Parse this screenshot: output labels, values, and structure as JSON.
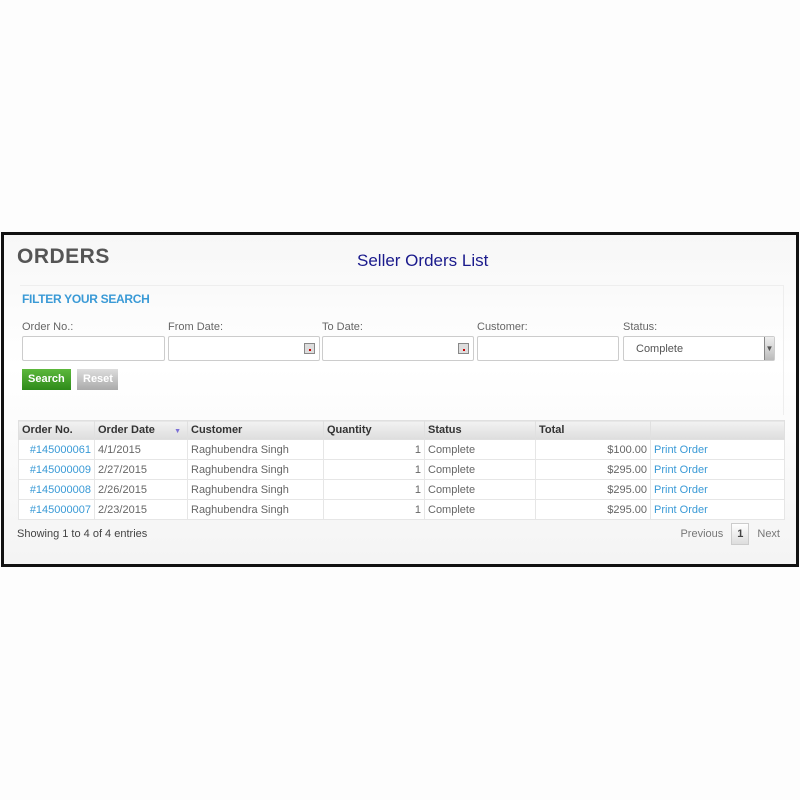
{
  "header": {
    "title": "ORDERS",
    "subtitle": "Seller Orders List"
  },
  "filter": {
    "heading": "FILTER YOUR SEARCH",
    "order_no_label": "Order No.:",
    "from_date_label": "From Date:",
    "to_date_label": "To Date:",
    "customer_label": "Customer:",
    "status_label": "Status:",
    "status_value": "Complete",
    "search_label": "Search",
    "reset_label": "Reset"
  },
  "table": {
    "columns": [
      "Order No.",
      "Order Date",
      "Customer",
      "Quantity",
      "Status",
      "Total",
      ""
    ],
    "rows": [
      [
        "#145000061",
        "4/1/2015",
        "Raghubendra Singh",
        "1",
        "Complete",
        "$100.00",
        "Print Order"
      ],
      [
        "#145000009",
        "2/27/2015",
        "Raghubendra Singh",
        "1",
        "Complete",
        "$295.00",
        "Print Order"
      ],
      [
        "#145000008",
        "2/26/2015",
        "Raghubendra Singh",
        "1",
        "Complete",
        "$295.00",
        "Print Order"
      ],
      [
        "#145000007",
        "2/23/2015",
        "Raghubendra Singh",
        "1",
        "Complete",
        "$295.00",
        "Print Order"
      ]
    ]
  },
  "footer": {
    "info": "Showing 1 to 4 of 4 entries",
    "previous": "Previous",
    "page": "1",
    "next": "Next"
  }
}
